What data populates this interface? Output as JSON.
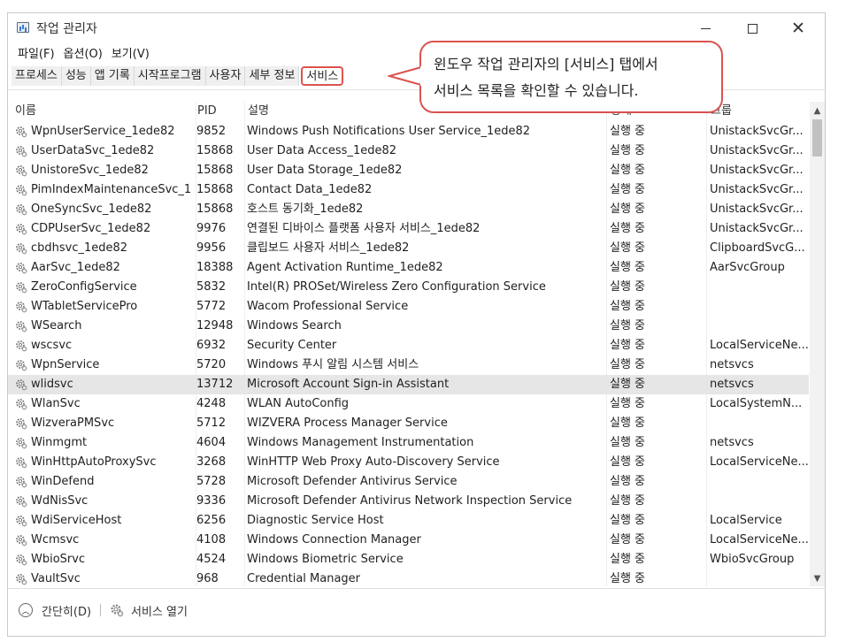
{
  "window": {
    "title": "작업 관리자",
    "menu": [
      "파일(F)",
      "옵션(O)",
      "보기(V)"
    ],
    "tabs": [
      "프로세스",
      "성능",
      "앱 기록",
      "시작프로그램",
      "사용자",
      "세부 정보",
      "서비스"
    ],
    "active_tab": "서비스"
  },
  "callout": {
    "line1": "윈도우 작업 관리자의 [서비스] 탭에서",
    "line2": "서비스 목록을 확인할 수 있습니다.",
    "border_color": "#d9534f"
  },
  "table": {
    "headers": [
      "이름",
      "PID",
      "설명",
      "상태",
      "그룹"
    ],
    "rows": [
      {
        "name": "WpnUserService_1ede82",
        "pid": "9852",
        "desc": "Windows Push Notifications User Service_1ede82",
        "status": "실행 중",
        "group": "UnistackSvcGr..."
      },
      {
        "name": "UserDataSvc_1ede82",
        "pid": "15868",
        "desc": "User Data Access_1ede82",
        "status": "실행 중",
        "group": "UnistackSvcGr..."
      },
      {
        "name": "UnistoreSvc_1ede82",
        "pid": "15868",
        "desc": "User Data Storage_1ede82",
        "status": "실행 중",
        "group": "UnistackSvcGr..."
      },
      {
        "name": "PimIndexMaintenanceSvc_1...",
        "pid": "15868",
        "desc": "Contact Data_1ede82",
        "status": "실행 중",
        "group": "UnistackSvcGr..."
      },
      {
        "name": "OneSyncSvc_1ede82",
        "pid": "15868",
        "desc": "호스트 동기화_1ede82",
        "status": "실행 중",
        "group": "UnistackSvcGr..."
      },
      {
        "name": "CDPUserSvc_1ede82",
        "pid": "9976",
        "desc": "연결된 디바이스 플랫폼 사용자 서비스_1ede82",
        "status": "실행 중",
        "group": "UnistackSvcGr..."
      },
      {
        "name": "cbdhsvc_1ede82",
        "pid": "9956",
        "desc": "클립보드 사용자 서비스_1ede82",
        "status": "실행 중",
        "group": "ClipboardSvcG..."
      },
      {
        "name": "AarSvc_1ede82",
        "pid": "18388",
        "desc": "Agent Activation Runtime_1ede82",
        "status": "실행 중",
        "group": "AarSvcGroup"
      },
      {
        "name": "ZeroConfigService",
        "pid": "5832",
        "desc": "Intel(R) PROSet/Wireless Zero Configuration Service",
        "status": "실행 중",
        "group": ""
      },
      {
        "name": "WTabletServicePro",
        "pid": "5772",
        "desc": "Wacom Professional Service",
        "status": "실행 중",
        "group": ""
      },
      {
        "name": "WSearch",
        "pid": "12948",
        "desc": "Windows Search",
        "status": "실행 중",
        "group": ""
      },
      {
        "name": "wscsvc",
        "pid": "6932",
        "desc": "Security Center",
        "status": "실행 중",
        "group": "LocalServiceNe..."
      },
      {
        "name": "WpnService",
        "pid": "5720",
        "desc": "Windows 푸시 알림 시스템 서비스",
        "status": "실행 중",
        "group": "netsvcs"
      },
      {
        "name": "wlidsvc",
        "pid": "13712",
        "desc": "Microsoft Account Sign-in Assistant",
        "status": "실행 중",
        "group": "netsvcs",
        "selected": true
      },
      {
        "name": "WlanSvc",
        "pid": "4248",
        "desc": "WLAN AutoConfig",
        "status": "실행 중",
        "group": "LocalSystemN..."
      },
      {
        "name": "WizveraPMSvc",
        "pid": "5712",
        "desc": "WIZVERA Process Manager Service",
        "status": "실행 중",
        "group": ""
      },
      {
        "name": "Winmgmt",
        "pid": "4604",
        "desc": "Windows Management Instrumentation",
        "status": "실행 중",
        "group": "netsvcs"
      },
      {
        "name": "WinHttpAutoProxySvc",
        "pid": "3268",
        "desc": "WinHTTP Web Proxy Auto-Discovery Service",
        "status": "실행 중",
        "group": "LocalServiceNe..."
      },
      {
        "name": "WinDefend",
        "pid": "5728",
        "desc": "Microsoft Defender Antivirus Service",
        "status": "실행 중",
        "group": ""
      },
      {
        "name": "WdNisSvc",
        "pid": "9336",
        "desc": "Microsoft Defender Antivirus Network Inspection Service",
        "status": "실행 중",
        "group": ""
      },
      {
        "name": "WdiServiceHost",
        "pid": "6256",
        "desc": "Diagnostic Service Host",
        "status": "실행 중",
        "group": "LocalService"
      },
      {
        "name": "Wcmsvc",
        "pid": "4108",
        "desc": "Windows Connection Manager",
        "status": "실행 중",
        "group": "LocalServiceNe..."
      },
      {
        "name": "WbioSrvc",
        "pid": "4524",
        "desc": "Windows Biometric Service",
        "status": "실행 중",
        "group": "WbioSvcGroup"
      },
      {
        "name": "VaultSvc",
        "pid": "968",
        "desc": "Credential Manager",
        "status": "실행 중",
        "group": ""
      }
    ]
  },
  "bottom": {
    "collapse_label": "간단히(D)",
    "open_services_label": "서비스 열기"
  },
  "icons": {
    "row_icon": "gear-icon",
    "collapse": "chevron-up-icon"
  }
}
